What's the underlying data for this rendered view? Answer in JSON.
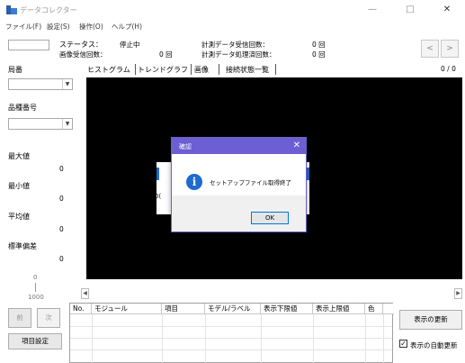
{
  "window": {
    "title": "データコレクター",
    "minimize": "—",
    "maximize": "□",
    "close": "✕"
  },
  "menu": [
    "ファイル(F)",
    "設定(S)",
    "操作(O)",
    "ヘルプ(H)"
  ],
  "status": {
    "status_label": "ステータス：",
    "status_value": "停止中",
    "image_recv_label": "画像受信回数：",
    "image_recv_value": "0 回",
    "meas_recv_label": "計測データ受信回数：",
    "meas_recv_value": "0 回",
    "meas_proc_label": "計測データ処理済回数：",
    "meas_proc_value": "0 回"
  },
  "left_panel": {
    "station_label": "局番",
    "product_label": "品種番号",
    "max_label": "最大値",
    "max_value": "0",
    "min_label": "最小値",
    "min_value": "0",
    "avg_label": "平均値",
    "avg_value": "0",
    "std_label": "標準偏差",
    "std_value": "0",
    "slider_top": "0",
    "slider_bottom": "1000"
  },
  "nav": {
    "prev": "<",
    "next": ">",
    "page": "0 / 0"
  },
  "tabs": [
    "ヒストグラム",
    "トレンドグラフ",
    "画像",
    "接続状態一覧"
  ],
  "dialog": {
    "title": "確認",
    "close": "✕",
    "icon": "i",
    "message": "セットアップファイル取得終了",
    "ok": "OK",
    "behind_text": "0("
  },
  "bottom": {
    "prev_button": "前",
    "next_button": "次",
    "item_settings_button": "項目設定",
    "refresh_button": "表示の更新",
    "auto_refresh_label": "表示の自動更新",
    "auto_refresh_checked": true
  },
  "table": {
    "columns": [
      "No.",
      "モジュール",
      "項目",
      "モデル/ラベル",
      "表示下限値",
      "表示上限値",
      "色"
    ]
  }
}
